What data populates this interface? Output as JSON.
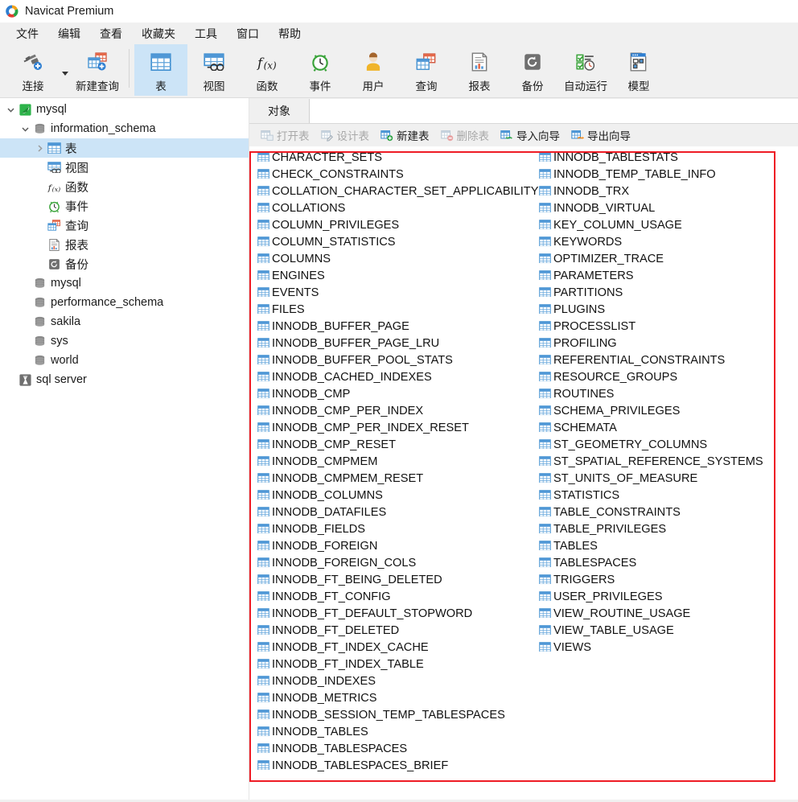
{
  "window": {
    "title": "Navicat Premium",
    "logo_icon": "navicat-logo-icon"
  },
  "menubar": {
    "items": [
      {
        "label": "文件",
        "name": "menu-file"
      },
      {
        "label": "编辑",
        "name": "menu-edit"
      },
      {
        "label": "查看",
        "name": "menu-view"
      },
      {
        "label": "收藏夹",
        "name": "menu-favorites"
      },
      {
        "label": "工具",
        "name": "menu-tools"
      },
      {
        "label": "窗口",
        "name": "menu-window"
      },
      {
        "label": "帮助",
        "name": "menu-help"
      }
    ]
  },
  "toolbar": {
    "buttons": [
      {
        "label": "连接",
        "icon": "connection-plug-icon",
        "active": false,
        "has_caret": true
      },
      {
        "label": "新建查询",
        "icon": "new-query-icon",
        "active": false,
        "has_caret": false
      },
      {
        "label": "表",
        "icon": "table-grid-icon",
        "active": true,
        "has_caret": false
      },
      {
        "label": "视图",
        "icon": "view-icon",
        "active": false,
        "has_caret": false
      },
      {
        "label": "函数",
        "icon": "function-fx-icon",
        "active": false,
        "has_caret": false
      },
      {
        "label": "事件",
        "icon": "event-clock-icon",
        "active": false,
        "has_caret": false
      },
      {
        "label": "用户",
        "icon": "user-person-icon",
        "active": false,
        "has_caret": false
      },
      {
        "label": "查询",
        "icon": "query-icon",
        "active": false,
        "has_caret": false
      },
      {
        "label": "报表",
        "icon": "report-document-icon",
        "active": false,
        "has_caret": false
      },
      {
        "label": "备份",
        "icon": "backup-disk-icon",
        "active": false,
        "has_caret": false
      },
      {
        "label": "自动运行",
        "icon": "automation-schedule-icon",
        "active": false,
        "has_caret": false
      },
      {
        "label": "模型",
        "icon": "model-diagram-icon",
        "active": false,
        "has_caret": false
      }
    ]
  },
  "sidebar": {
    "nodes": [
      {
        "label": "mysql",
        "icon": "mysql-connection-icon",
        "indent": 0,
        "twisty": "expanded",
        "selected": false
      },
      {
        "label": "information_schema",
        "icon": "database-icon",
        "indent": 1,
        "twisty": "expanded",
        "selected": false
      },
      {
        "label": "表",
        "icon": "table-grid-icon",
        "indent": 2,
        "twisty": "collapsed",
        "selected": true
      },
      {
        "label": "视图",
        "icon": "view-icon",
        "indent": 2,
        "twisty": "none",
        "selected": false
      },
      {
        "label": "函数",
        "icon": "function-fx-icon",
        "indent": 2,
        "twisty": "none",
        "selected": false
      },
      {
        "label": "事件",
        "icon": "event-clock-icon",
        "indent": 2,
        "twisty": "none",
        "selected": false
      },
      {
        "label": "查询",
        "icon": "query-icon",
        "indent": 2,
        "twisty": "none",
        "selected": false
      },
      {
        "label": "报表",
        "icon": "report-document-icon",
        "indent": 2,
        "twisty": "none",
        "selected": false
      },
      {
        "label": "备份",
        "icon": "backup-disk-icon",
        "indent": 2,
        "twisty": "none",
        "selected": false
      },
      {
        "label": "mysql",
        "icon": "database-icon",
        "indent": 1,
        "twisty": "none",
        "selected": false
      },
      {
        "label": "performance_schema",
        "icon": "database-icon",
        "indent": 1,
        "twisty": "none",
        "selected": false
      },
      {
        "label": "sakila",
        "icon": "database-icon",
        "indent": 1,
        "twisty": "none",
        "selected": false
      },
      {
        "label": "sys",
        "icon": "database-icon",
        "indent": 1,
        "twisty": "none",
        "selected": false
      },
      {
        "label": "world",
        "icon": "database-icon",
        "indent": 1,
        "twisty": "none",
        "selected": false
      },
      {
        "label": "sql server",
        "icon": "sqlserver-connection-icon",
        "indent": 0,
        "twisty": "none",
        "selected": false
      }
    ]
  },
  "content": {
    "tabs": [
      {
        "label": "对象",
        "name": "tab-objects",
        "active": true
      }
    ],
    "object_toolbar": [
      {
        "label": "打开表",
        "icon": "open-table-icon",
        "disabled": true
      },
      {
        "label": "设计表",
        "icon": "design-table-icon",
        "disabled": true
      },
      {
        "label": "新建表",
        "icon": "new-table-icon",
        "disabled": false
      },
      {
        "label": "删除表",
        "icon": "delete-table-icon",
        "disabled": true
      },
      {
        "label": "导入向导",
        "icon": "import-wizard-icon",
        "disabled": false
      },
      {
        "label": "导出向导",
        "icon": "export-wizard-icon",
        "disabled": false
      }
    ],
    "item_icon": "table-grid-icon",
    "table_list_column1": [
      "CHARACTER_SETS",
      "CHECK_CONSTRAINTS",
      "COLLATION_CHARACTER_SET_APPLICABILITY",
      "COLLATIONS",
      "COLUMN_PRIVILEGES",
      "COLUMN_STATISTICS",
      "COLUMNS",
      "ENGINES",
      "EVENTS",
      "FILES",
      "INNODB_BUFFER_PAGE",
      "INNODB_BUFFER_PAGE_LRU",
      "INNODB_BUFFER_POOL_STATS",
      "INNODB_CACHED_INDEXES",
      "INNODB_CMP",
      "INNODB_CMP_PER_INDEX",
      "INNODB_CMP_PER_INDEX_RESET",
      "INNODB_CMP_RESET",
      "INNODB_CMPMEM",
      "INNODB_CMPMEM_RESET",
      "INNODB_COLUMNS",
      "INNODB_DATAFILES",
      "INNODB_FIELDS",
      "INNODB_FOREIGN",
      "INNODB_FOREIGN_COLS",
      "INNODB_FT_BEING_DELETED",
      "INNODB_FT_CONFIG",
      "INNODB_FT_DEFAULT_STOPWORD",
      "INNODB_FT_DELETED",
      "INNODB_FT_INDEX_CACHE",
      "INNODB_FT_INDEX_TABLE",
      "INNODB_INDEXES",
      "INNODB_METRICS",
      "INNODB_SESSION_TEMP_TABLESPACES",
      "INNODB_TABLES",
      "INNODB_TABLESPACES",
      "INNODB_TABLESPACES_BRIEF"
    ],
    "table_list_column2": [
      "INNODB_TABLESTATS",
      "INNODB_TEMP_TABLE_INFO",
      "INNODB_TRX",
      "INNODB_VIRTUAL",
      "KEY_COLUMN_USAGE",
      "KEYWORDS",
      "OPTIMIZER_TRACE",
      "PARAMETERS",
      "PARTITIONS",
      "PLUGINS",
      "PROCESSLIST",
      "PROFILING",
      "REFERENTIAL_CONSTRAINTS",
      "RESOURCE_GROUPS",
      "ROUTINES",
      "SCHEMA_PRIVILEGES",
      "SCHEMATA",
      "ST_GEOMETRY_COLUMNS",
      "ST_SPATIAL_REFERENCE_SYSTEMS",
      "ST_UNITS_OF_MEASURE",
      "STATISTICS",
      "TABLE_CONSTRAINTS",
      "TABLE_PRIVILEGES",
      "TABLES",
      "TABLESPACES",
      "TRIGGERS",
      "USER_PRIVILEGES",
      "VIEW_ROUTINE_USAGE",
      "VIEW_TABLE_USAGE",
      "VIEWS"
    ]
  },
  "annotation": {
    "name": "red-highlight-rectangle",
    "color": "#ee1c25"
  },
  "colors": {
    "selection_blue": "#cce4f7",
    "chrome_gray": "#f0f0f0",
    "table_icon_blue": "#3f8fd0",
    "annotation_red": "#ee1c25"
  }
}
